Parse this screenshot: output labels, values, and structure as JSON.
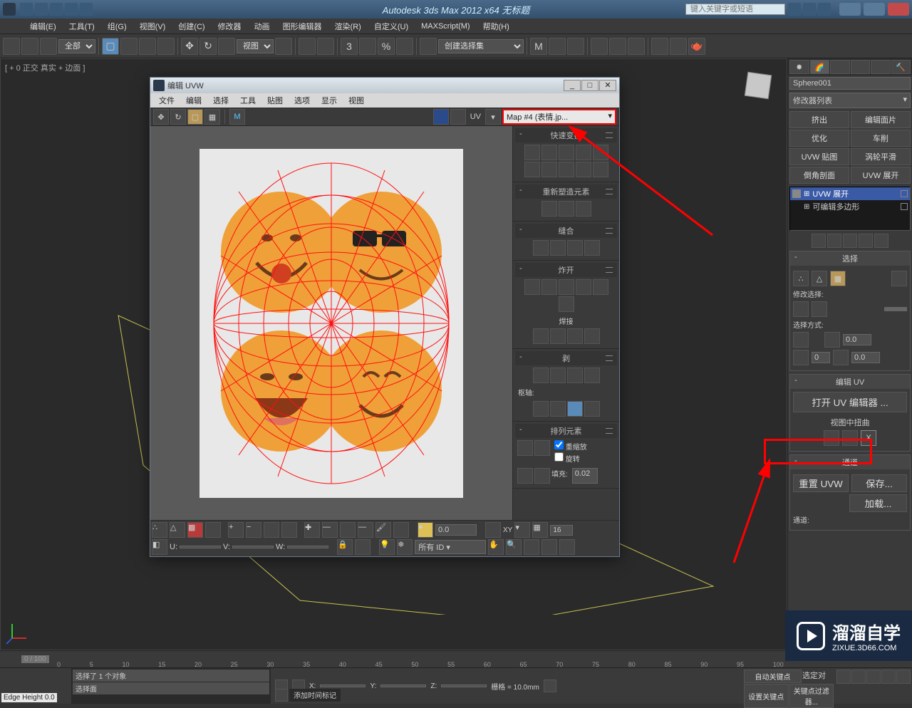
{
  "titlebar": {
    "app_title": "Autodesk 3ds Max 2012 x64   无标题",
    "search_placeholder": "键入关键字或短语"
  },
  "menubar": {
    "items": [
      "编辑(E)",
      "工具(T)",
      "组(G)",
      "视图(V)",
      "创建(C)",
      "修改器",
      "动画",
      "图形编辑器",
      "渲染(R)",
      "自定义(U)",
      "MAXScript(M)",
      "帮助(H)"
    ]
  },
  "toolbar": {
    "filter": "全部",
    "view_combo": "视图",
    "selection_set": "创建选择集"
  },
  "viewport": {
    "label": "[ + 0 正交 真实 + 边面 ]"
  },
  "command_panel": {
    "object_name": "Sphere001",
    "modifier_list": "修改器列表",
    "btn_grid": [
      "挤出",
      "编辑面片",
      "优化",
      "车削",
      "UVW 贴图",
      "涡轮平滑",
      "倒角剖面",
      "UVW 展开"
    ],
    "stack": [
      {
        "label": "UVW 展开",
        "active": true
      },
      {
        "label": "可编辑多边形",
        "active": false
      }
    ],
    "rollout_select": {
      "title": "选择",
      "modify_sel": "修改选择:",
      "select_by": "选择方式:",
      "spin1": "0.0",
      "spin2": "0",
      "spin3": "0.0"
    },
    "rollout_edituv": {
      "title": "编辑 UV",
      "open_btn": "打开 UV 编辑器 ...",
      "tweak": "视图中扭曲"
    },
    "rollout_channel": {
      "title": "通道",
      "reset": "重置 UVW",
      "save": "保存...",
      "load": "加载...",
      "channel_lbl": "通道:"
    }
  },
  "uvw_editor": {
    "title": "编辑 UVW",
    "menu": [
      "文件",
      "编辑",
      "选择",
      "工具",
      "贴图",
      "选项",
      "显示",
      "视图"
    ],
    "uv_label": "UV",
    "map_selection": "Map #4 (表情.jp...",
    "sections": {
      "quick_xform": "快速变换",
      "reshape": "重新塑造元素",
      "stitch": "缝合",
      "explode": "炸开",
      "weld": "焊接",
      "pivot": "枢轴:",
      "peel": "剥",
      "arrange": "排列元素",
      "rescale": "重缩放",
      "rotate": "旋转",
      "padding": "填充:",
      "pad_val": "0.02"
    },
    "status": {
      "u": "U:",
      "v": "V:",
      "w": "W:",
      "xy": "XY",
      "spin0": "0.0",
      "spin16": "16",
      "all_id": "所有 ID"
    }
  },
  "timeline": {
    "frame": "0 / 100",
    "ticks": [
      "0",
      "5",
      "10",
      "15",
      "20",
      "25",
      "30",
      "35",
      "40",
      "45",
      "50",
      "55",
      "60",
      "65",
      "70",
      "75",
      "80",
      "85",
      "90",
      "95",
      "100"
    ]
  },
  "statusbar": {
    "edge_height": "Edge Height 0.0",
    "prompt1": "选择了 1 个对象",
    "prompt2": "选择面",
    "x": "X:",
    "y": "Y:",
    "z": "Z:",
    "grid": "栅格 = 10.0mm",
    "autokey": "自动关键点",
    "selset": "选定对",
    "add_time": "添加时间标记",
    "setkey": "设置关键点",
    "keyfilter": "关键点过滤器..."
  },
  "watermark": {
    "brand": "溜溜自学",
    "url": "ZIXUE.3D66.COM"
  }
}
